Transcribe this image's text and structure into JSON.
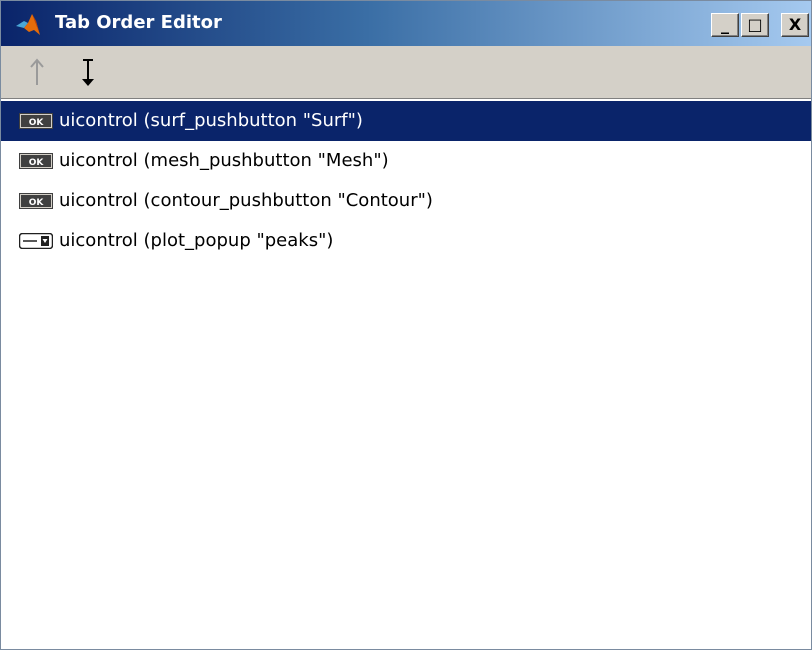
{
  "window": {
    "title": "Tab Order Editor",
    "controls": {
      "minimize": "_",
      "maximize": "□",
      "close": "X"
    }
  },
  "toolbar": {
    "move_up": {
      "icon": "up-arrow-icon",
      "enabled": false
    },
    "move_down": {
      "icon": "down-arrow-icon",
      "enabled": true
    }
  },
  "list": {
    "items": [
      {
        "label": "uicontrol (surf_pushbutton \"Surf\")",
        "icon": "pushbutton-icon",
        "icon_text": "OK",
        "selected": true
      },
      {
        "label": "uicontrol (mesh_pushbutton \"Mesh\")",
        "icon": "pushbutton-icon",
        "icon_text": "OK",
        "selected": false
      },
      {
        "label": "uicontrol (contour_pushbutton \"Contour\")",
        "icon": "pushbutton-icon",
        "icon_text": "OK",
        "selected": false
      },
      {
        "label": "uicontrol (plot_popup \"peaks\")",
        "icon": "popupmenu-icon",
        "selected": false
      }
    ]
  },
  "colors": {
    "selection": "#0a246a",
    "title_gradient_start": "#0a246a",
    "title_gradient_end": "#a6caf0"
  }
}
